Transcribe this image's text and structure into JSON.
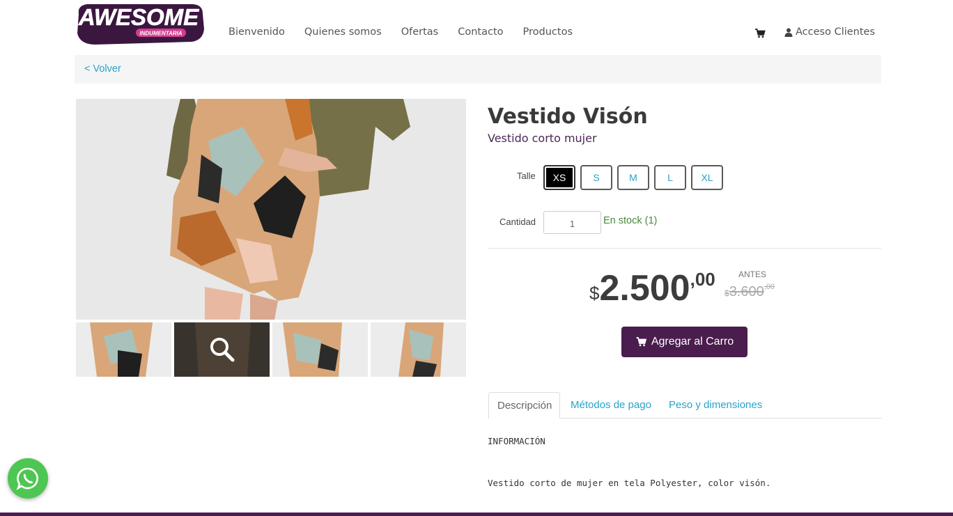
{
  "brand": {
    "logo_text": "AWESOME",
    "logo_sub": "INDUMENTARIA"
  },
  "nav": {
    "items": [
      "Bienvenido",
      "Quienes somos",
      "Ofertas",
      "Contacto",
      "Productos"
    ]
  },
  "header": {
    "access_label": "Acceso Clientes"
  },
  "breadcrumb": {
    "back_label": "< Volver"
  },
  "product": {
    "title": "Vestido Visón",
    "subtitle": "Vestido corto mujer",
    "size_label": "Talle",
    "sizes": [
      "XS",
      "S",
      "M",
      "L",
      "XL"
    ],
    "selected_size": "XS",
    "quantity_label": "Cantidad",
    "quantity_value": "1",
    "stock_text": "En stock (1)",
    "price": {
      "currency": "$",
      "integer": "2.500",
      "decimals": ",00"
    },
    "old_price_label": "ANTES",
    "old_price": {
      "currency": "$",
      "integer": "3.600",
      "decimals": ",00"
    },
    "add_to_cart_label": "Agregar al Carro"
  },
  "tabs": [
    "Descripción",
    "Métodos de pago",
    "Peso y dimensiones"
  ],
  "description": {
    "heading": "INFORMACIÓN",
    "text": "Vestido corto de mujer en tela Polyester, color visón."
  },
  "colors": {
    "brand_purple": "#4a1d4e",
    "link_blue": "#29a3c9",
    "stock_green": "#4a8a3a",
    "whatsapp_green": "#4ec653"
  }
}
